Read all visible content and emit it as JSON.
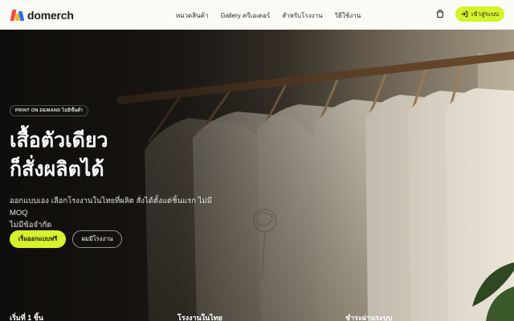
{
  "brand": {
    "name": "domerch",
    "colors": {
      "accent": "#d6f22b",
      "mark_red": "#f04a3c",
      "mark_yellow": "#f7b928",
      "mark_blue": "#2f6cf0"
    }
  },
  "nav": {
    "links": [
      "หมวดสินค้า",
      "Gallery ครีเอเตอร์",
      "สำหรับโรงงาน",
      "วิธีใช้งาน"
    ],
    "cart_icon": "cart-icon",
    "login_label": "เข้าสู่ระบบ",
    "login_icon": "login-icon"
  },
  "hero": {
    "badge": "PRINT ON DEMAND ไม่มีขั้นต่ำ",
    "headline_line1": "เสื้อตัวเดียว",
    "headline_line2": "ก็สั่งผลิตได้",
    "sub_line1": "ออกแบบเอง เลือกโรงงานในไทยที่ผลิต สั่งได้ตั้งแต่ชิ้นแรก ไม่มี MOQ",
    "sub_line2": "ไม่มีข้อจำกัด",
    "cta_primary": "เริ่มออกแบบฟรี",
    "cta_secondary": "ผมมีโรงงาน",
    "image_subject": "rack of cream t-shirts on wooden hangers"
  },
  "features": [
    "เริ่มที่ 1 ชิ้น",
    "โรงงานในไทย",
    "ชำระผ่านระบบ"
  ]
}
